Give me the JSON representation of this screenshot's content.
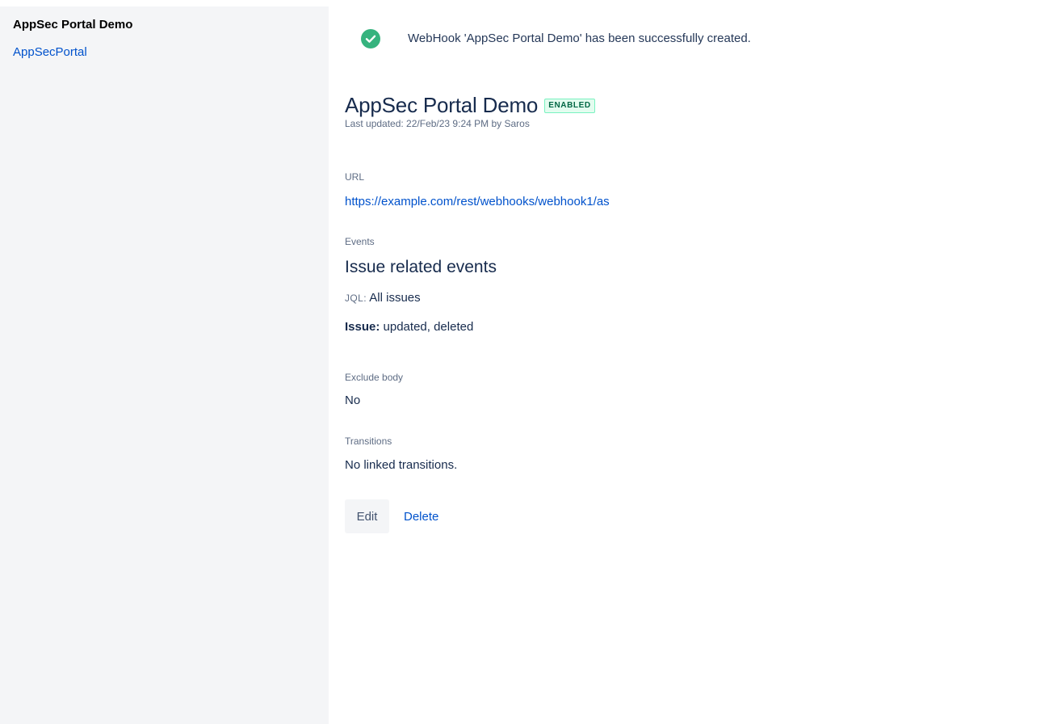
{
  "sidebar": {
    "title": "AppSec Portal Demo",
    "link": "AppSecPortal"
  },
  "flag": {
    "icon": "success-check-icon",
    "color": "#36b37e",
    "message": "WebHook 'AppSec Portal Demo' has been successfully created."
  },
  "webhook": {
    "name": "AppSec Portal Demo",
    "status": "ENABLED",
    "last_updated": "Last updated: 22/Feb/23 9:24 PM by Saros",
    "url_label": "URL",
    "url": "https://example.com/rest/webhooks/webhook1/as",
    "events_label": "Events",
    "events_heading": "Issue related events",
    "jql_key": "JQL:",
    "jql_value": " All issues",
    "issue_key": "Issue:",
    "issue_value": " updated, deleted",
    "exclude_body_label": "Exclude body",
    "exclude_body_value": "No",
    "transitions_label": "Transitions",
    "transitions_value": "No linked transitions."
  },
  "actions": {
    "edit_label": "Edit",
    "delete_label": "Delete"
  }
}
